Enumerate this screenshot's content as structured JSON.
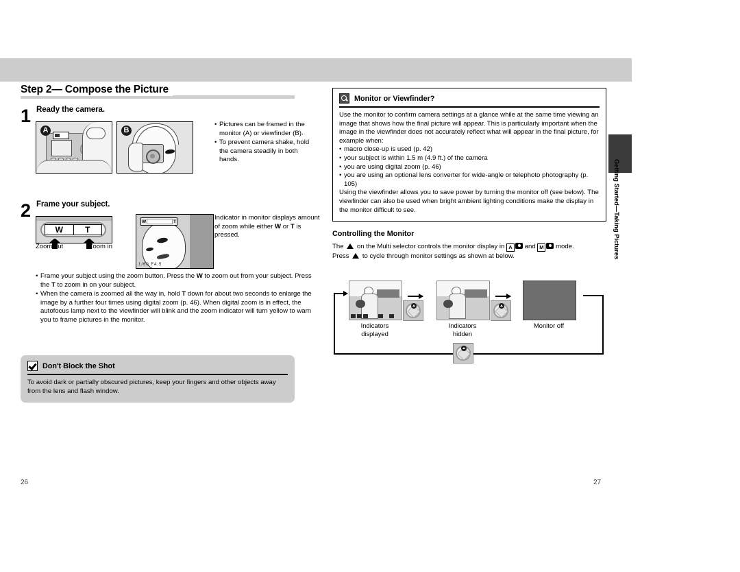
{
  "document": {
    "left_page_number": "26",
    "right_page_number": "27",
    "side_tab": "Getting Started—Taking Pictures"
  },
  "left_page": {
    "step_title": "Step 2— Compose the Picture",
    "step1": {
      "number": "1",
      "heading": "Ready the camera.",
      "figure_a_badge": "A",
      "figure_b_badge": "B",
      "bullets": [
        "Pictures can be framed in the monitor (A) or viewfinder (B).",
        "To prevent camera shake, hold the camera steadily in both hands."
      ]
    },
    "step2": {
      "number": "2",
      "heading": "Frame your subject.",
      "zoom_button_w": "W",
      "zoom_button_t": "T",
      "zoom_out_label": "Zoom out",
      "zoom_in_label": "Zoom in",
      "monitor_note": "Indicator in monitor displays amount of zoom while either W or T is pressed.",
      "monitor_zoom_w": "W",
      "monitor_zoom_t": "T",
      "monitor_status": "1/60  F4.5",
      "bullets": [
        "Frame your subject using the zoom button. Press the W to zoom out from your subject. Press the T to zoom in on your subject.",
        "When the camera is zoomed all the way in, hold T down for about two seconds to enlarge the image by a further four times using digital zoom (p. 46). When digital zoom is in effect, the autofocus lamp next to the viewfinder will blink and the zoom indicator will turn yellow to warn you to frame pictures in the monitor."
      ]
    },
    "caution": {
      "icon": "checkmark-icon",
      "title": "Don't Block the Shot",
      "body": "To avoid dark or partially obscured pictures, keep your fingers and other objects away from the lens and flash window."
    }
  },
  "right_page": {
    "tip": {
      "icon": "magnifier-icon",
      "title": "Monitor or Viewfinder?",
      "intro": "Use the monitor to confirm camera settings at a glance while at the same time viewing an image that shows how the final picture will appear. This is particularly important when the image in the viewfinder does not accurately reflect what will appear in the final picture, for example when:",
      "bullets": [
        "macro close-up is used (p. 42)",
        "your subject is within 1.5 m (4.9 ft.) of the camera",
        "you are using digital zoom (p. 46)",
        "you are using an optional lens converter for wide-angle or telephoto photography (p. 105)"
      ],
      "outro": "Using the viewfinder allows you to save power by turning the monitor off (see below). The viewfinder can also be used when bright ambient lighting conditions make the display in the monitor difficult to see."
    },
    "controlling": {
      "heading": "Controlling the Monitor",
      "line1_part1": "The",
      "line1_part2": "on the Multi selector controls the monitor display in",
      "mode_a_letter": "A",
      "line1_part3": "and",
      "mode_m_letter": "M",
      "line1_part4": "mode.",
      "line2_part1": "Press",
      "line2_part2": "to cycle through monitor settings as shown at below."
    },
    "cycle_diagram": {
      "state1_label_line1": "Indicators",
      "state1_label_line2": "displayed",
      "state2_label_line1": "Indicators",
      "state2_label_line2": "hidden",
      "state3_label": "Monitor off",
      "selector_icon": "multi-selector-up-icon"
    }
  },
  "colors": {
    "banner_gray": "#cccccc",
    "caution_box_gray": "#cccccc",
    "monitor_off_gray": "#6e6e6e",
    "side_tab_dark": "#3b3b3b",
    "rule_gray": "#cfcfcf"
  }
}
